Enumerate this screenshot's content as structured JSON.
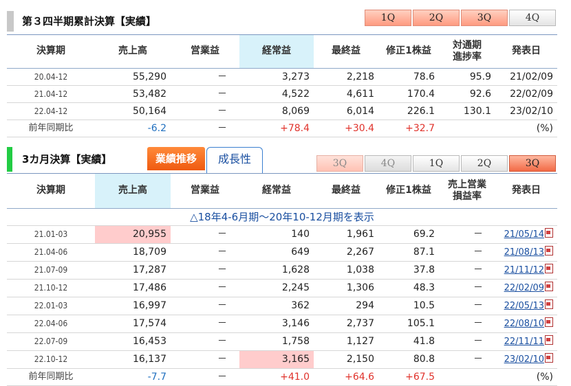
{
  "section1": {
    "title": "第３四半期累計決算【実績】",
    "tabs": [
      "1Q",
      "2Q",
      "3Q",
      "4Q"
    ],
    "headers": [
      "決算期",
      "売上高",
      "営業益",
      "経常益",
      "最終益",
      "修正1株益",
      "対通期\n進捗率",
      "発表日"
    ],
    "rows": [
      {
        "period": "20.04-12",
        "sales": "55,290",
        "op": "－",
        "ord": "3,273",
        "net": "2,218",
        "eps": "78.6",
        "prog": "95.9",
        "date": "21/02/09"
      },
      {
        "period": "21.04-12",
        "sales": "53,482",
        "op": "－",
        "ord": "4,522",
        "net": "4,611",
        "eps": "170.4",
        "prog": "92.6",
        "date": "22/02/09"
      },
      {
        "period": "22.04-12",
        "sales": "50,164",
        "op": "－",
        "ord": "8,069",
        "net": "6,014",
        "eps": "226.1",
        "prog": "130.1",
        "date": "23/02/10"
      }
    ],
    "yoy": {
      "label": "前年同期比",
      "sales": "-6.2",
      "op": "－",
      "ord": "+78.4",
      "net": "+30.4",
      "eps": "+32.7",
      "unit": "(%)"
    }
  },
  "section2": {
    "title": "3カ月決算【実績】",
    "tab_active": "業績推移",
    "tab_other": "成長性",
    "qtabs": [
      "3Q",
      "4Q",
      "1Q",
      "2Q",
      "3Q"
    ],
    "headers": [
      "決算期",
      "売上高",
      "営業益",
      "経常益",
      "最終益",
      "修正1株益",
      "売上営業\n損益率",
      "発表日"
    ],
    "show_link": "△18年4-6月期～20年10-12月期を表示",
    "rows": [
      {
        "period": "21.01-03",
        "sales": "20,955",
        "op": "－",
        "ord": "140",
        "net": "1,961",
        "eps": "69.2",
        "margin": "－",
        "date": "21/05/14"
      },
      {
        "period": "21.04-06",
        "sales": "18,709",
        "op": "－",
        "ord": "649",
        "net": "2,267",
        "eps": "87.1",
        "margin": "－",
        "date": "21/08/13"
      },
      {
        "period": "21.07-09",
        "sales": "17,287",
        "op": "－",
        "ord": "1,628",
        "net": "1,038",
        "eps": "37.8",
        "margin": "－",
        "date": "21/11/12"
      },
      {
        "period": "21.10-12",
        "sales": "17,486",
        "op": "－",
        "ord": "2,245",
        "net": "1,306",
        "eps": "48.3",
        "margin": "－",
        "date": "22/02/09"
      },
      {
        "period": "22.01-03",
        "sales": "16,997",
        "op": "－",
        "ord": "362",
        "net": "294",
        "eps": "10.5",
        "margin": "－",
        "date": "22/05/13"
      },
      {
        "period": "22.04-06",
        "sales": "17,574",
        "op": "－",
        "ord": "3,146",
        "net": "2,737",
        "eps": "105.1",
        "margin": "－",
        "date": "22/08/10"
      },
      {
        "period": "22.07-09",
        "sales": "16,453",
        "op": "－",
        "ord": "1,758",
        "net": "1,127",
        "eps": "41.8",
        "margin": "－",
        "date": "22/11/11"
      },
      {
        "period": "22.10-12",
        "sales": "16,137",
        "op": "－",
        "ord": "3,165",
        "net": "2,150",
        "eps": "80.8",
        "margin": "－",
        "date": "23/02/10"
      }
    ],
    "yoy": {
      "label": "前年同期比",
      "sales": "-7.7",
      "op": "－",
      "ord": "+41.0",
      "net": "+64.6",
      "eps": "+67.5",
      "unit": "(%)"
    }
  },
  "colors": {
    "highlight_header": "#d8f2fa",
    "highlight_cell": "#ffcccc",
    "negative": "#1f6fbf",
    "positive": "#e0322b"
  }
}
